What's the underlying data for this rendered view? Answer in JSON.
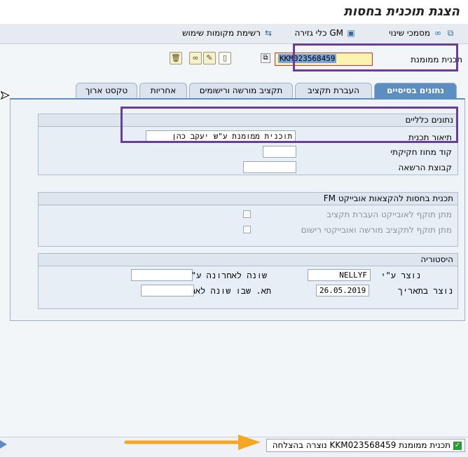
{
  "window": {
    "title": "הצגת תוכנית בחסות"
  },
  "toolbar": {
    "items": [
      {
        "label": "מסמכי שינוי",
        "icon": "document-copy-icon"
      },
      {
        "label": "GM כלי גזירה",
        "icon": "tools-icon"
      },
      {
        "label": "רשימת מקומות שימוש",
        "icon": "where-used-icon"
      }
    ]
  },
  "header": {
    "sponsored_program_label": "תכנית ממומנת",
    "sponsored_program_value": "KKM023568459"
  },
  "tabs": [
    {
      "label": "נתונים בסיסיים",
      "active": true
    },
    {
      "label": "העברת תקציב",
      "active": false
    },
    {
      "label": "תקציב מורשה ורישומים",
      "active": false
    },
    {
      "label": "אחריות",
      "active": false
    },
    {
      "label": "טקסט ארוך",
      "active": false
    }
  ],
  "general_data": {
    "title": "נתונים כלליים",
    "program_description_label": "תיאור תכנית",
    "program_description_value": "תוכנית ממומנת ע\"ש יעקב כהן",
    "legal_regulation_code_label": "קוד מחוז חקיקתי",
    "legal_regulation_code_value": "",
    "authorization_group_label": "קבוצת הרשאה",
    "authorization_group_value": ""
  },
  "fm_assignment": {
    "title": "תכנית בחסות להקצאות אובייקט FM",
    "budget_transfer_label": "מתן תוקף לאובייקט העברת תקציב",
    "posting_budget_label": "מתן תוקף לתקציב מורשה ואובייקטי רישום"
  },
  "history": {
    "title": "היסטוריה",
    "created_by_label": "נוצר ע\"י",
    "created_by_value": "NELLYF",
    "created_on_label": "נוצר בתאריך",
    "created_on_value": "26.05.2019",
    "last_changed_by_label": "שונה לאחרונה ע\"י",
    "last_changed_by_value": "",
    "changed_on_label": "תא. שבו שונה לאחר.",
    "changed_on_value": ""
  },
  "status": {
    "message": "תכנית ממומנת KKM023568459 נוצרה בהצלחה"
  },
  "colors": {
    "accent": "#5d8ec2",
    "highlight_box": "#6a3d9a",
    "arrow": "#f5a623",
    "success": "#2e9a35"
  }
}
